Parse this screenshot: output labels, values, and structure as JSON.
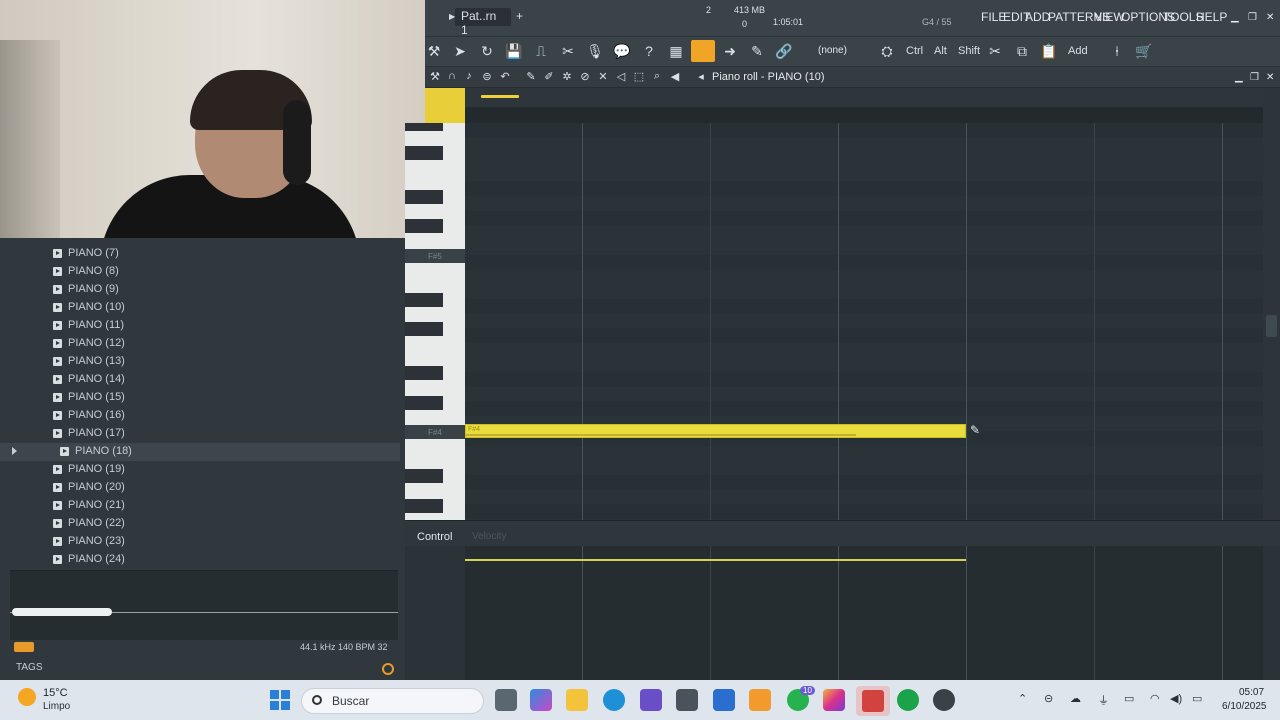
{
  "topbar": {
    "pattern_name": "Pat..rn 1",
    "memory": "413 MB",
    "cpu_top": "2",
    "cpu_bottom": "0",
    "time": "1:05:01",
    "voice": "G4 / 55",
    "menus": [
      "FILE",
      "EDIT",
      "ADD",
      "PATTERNS",
      "VIEW",
      "OPTIONS",
      "TOOLS",
      "HELP"
    ]
  },
  "toolbar2": {
    "snap": "(none)",
    "keys": [
      "Ctrl",
      "Alt",
      "Shift"
    ],
    "add": "Add"
  },
  "piano_roll": {
    "title": "Piano roll - PIANO (10)",
    "key_labels": [
      "F#5",
      "F#4"
    ],
    "note_label": "F#4",
    "control_label": "Control",
    "control_param": "Velocity"
  },
  "browser": {
    "items": [
      "PIANO (7)",
      "PIANO (8)",
      "PIANO (9)",
      "PIANO (10)",
      "PIANO (11)",
      "PIANO (12)",
      "PIANO (13)",
      "PIANO (14)",
      "PIANO (15)",
      "PIANO (16)",
      "PIANO (17)",
      "PIANO (18)",
      "PIANO (19)",
      "PIANO (20)",
      "PIANO (21)",
      "PIANO (22)",
      "PIANO (23)",
      "PIANO (24)"
    ],
    "selected": "PIANO (18)",
    "status": "44.1 kHz 140 BPM 32",
    "tags": "TAGS"
  },
  "taskbar": {
    "temperature": "15°C",
    "weather": "Limpo",
    "search_placeholder": "Buscar",
    "time": "05:07",
    "date": "6/10/2025",
    "badge": "10"
  },
  "colors": {
    "note": "#e9dd3e",
    "accent": "#f0a526",
    "background": "#2a3338"
  }
}
